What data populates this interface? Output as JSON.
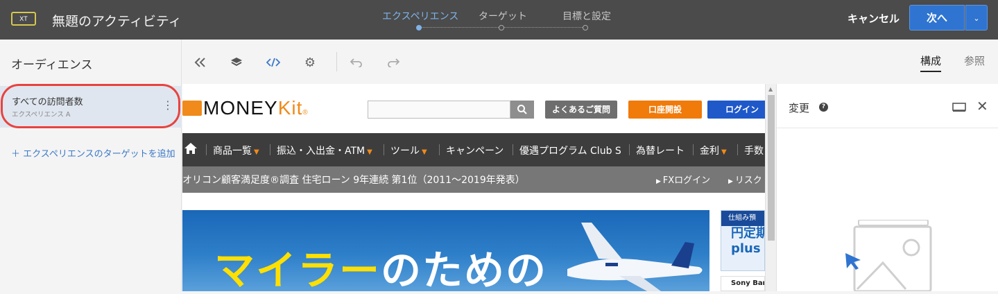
{
  "topbar": {
    "badge": "XT",
    "title": "無題のアクティビティ",
    "steps": [
      {
        "label": "エクスペリエンス",
        "active": true
      },
      {
        "label": "ターゲット",
        "active": false
      },
      {
        "label": "目標と設定",
        "active": false
      }
    ],
    "cancel_label": "キャンセル",
    "next_label": "次へ",
    "next_dropdown_icon": "chevron-down-icon"
  },
  "left_panel": {
    "title": "オーディエンス",
    "audience": {
      "name": "すべての訪問者数",
      "experience": "エクスペリエンス A",
      "menu_icon": "kebab-icon"
    },
    "add_target_label": "＋ エクスペリエンスのターゲットを追加"
  },
  "toolbar": {
    "icons": [
      "collapse-left-icon",
      "layers-icon",
      "code-icon",
      "gear-icon",
      "undo-icon",
      "redo-icon"
    ],
    "tabs": [
      {
        "label": "構成",
        "active": true
      },
      {
        "label": "参照",
        "active": false
      }
    ]
  },
  "preview": {
    "logo_text_main": "MONEY",
    "logo_text_accent": "Kit",
    "logo_reg": "®",
    "header_buttons": {
      "faq": "よくあるご質問",
      "open_account": "口座開設",
      "login": "ログイン"
    },
    "nav_items": [
      {
        "label": "商品一覧",
        "dropdown": true
      },
      {
        "label": "振込・入出金・ATM",
        "dropdown": true
      },
      {
        "label": "ツール",
        "dropdown": true
      },
      {
        "label": "キャンペーン",
        "dropdown": false
      },
      {
        "label": "優遇プログラム Club S",
        "dropdown": false
      },
      {
        "label": "為替レート",
        "dropdown": false
      },
      {
        "label": "金利",
        "dropdown": true
      },
      {
        "label": "手数",
        "dropdown": false
      }
    ],
    "news_text": "オリコン顧客満足度®調査 住宅ローン 9年連続 第1位（2011～2019年発表）",
    "news_links": [
      "FXログイン",
      "リスク"
    ],
    "hero_text_yellow": "マイラー",
    "hero_text_white": "のための",
    "side_banner": {
      "head": "仕組み預",
      "main1": "円定期",
      "main2": "plus",
      "footer": "Sony Ban"
    }
  },
  "right_panel": {
    "title": "変更",
    "help_icon": "help-icon",
    "screen_icon": "screen-icon",
    "close_icon": "close-icon"
  }
}
